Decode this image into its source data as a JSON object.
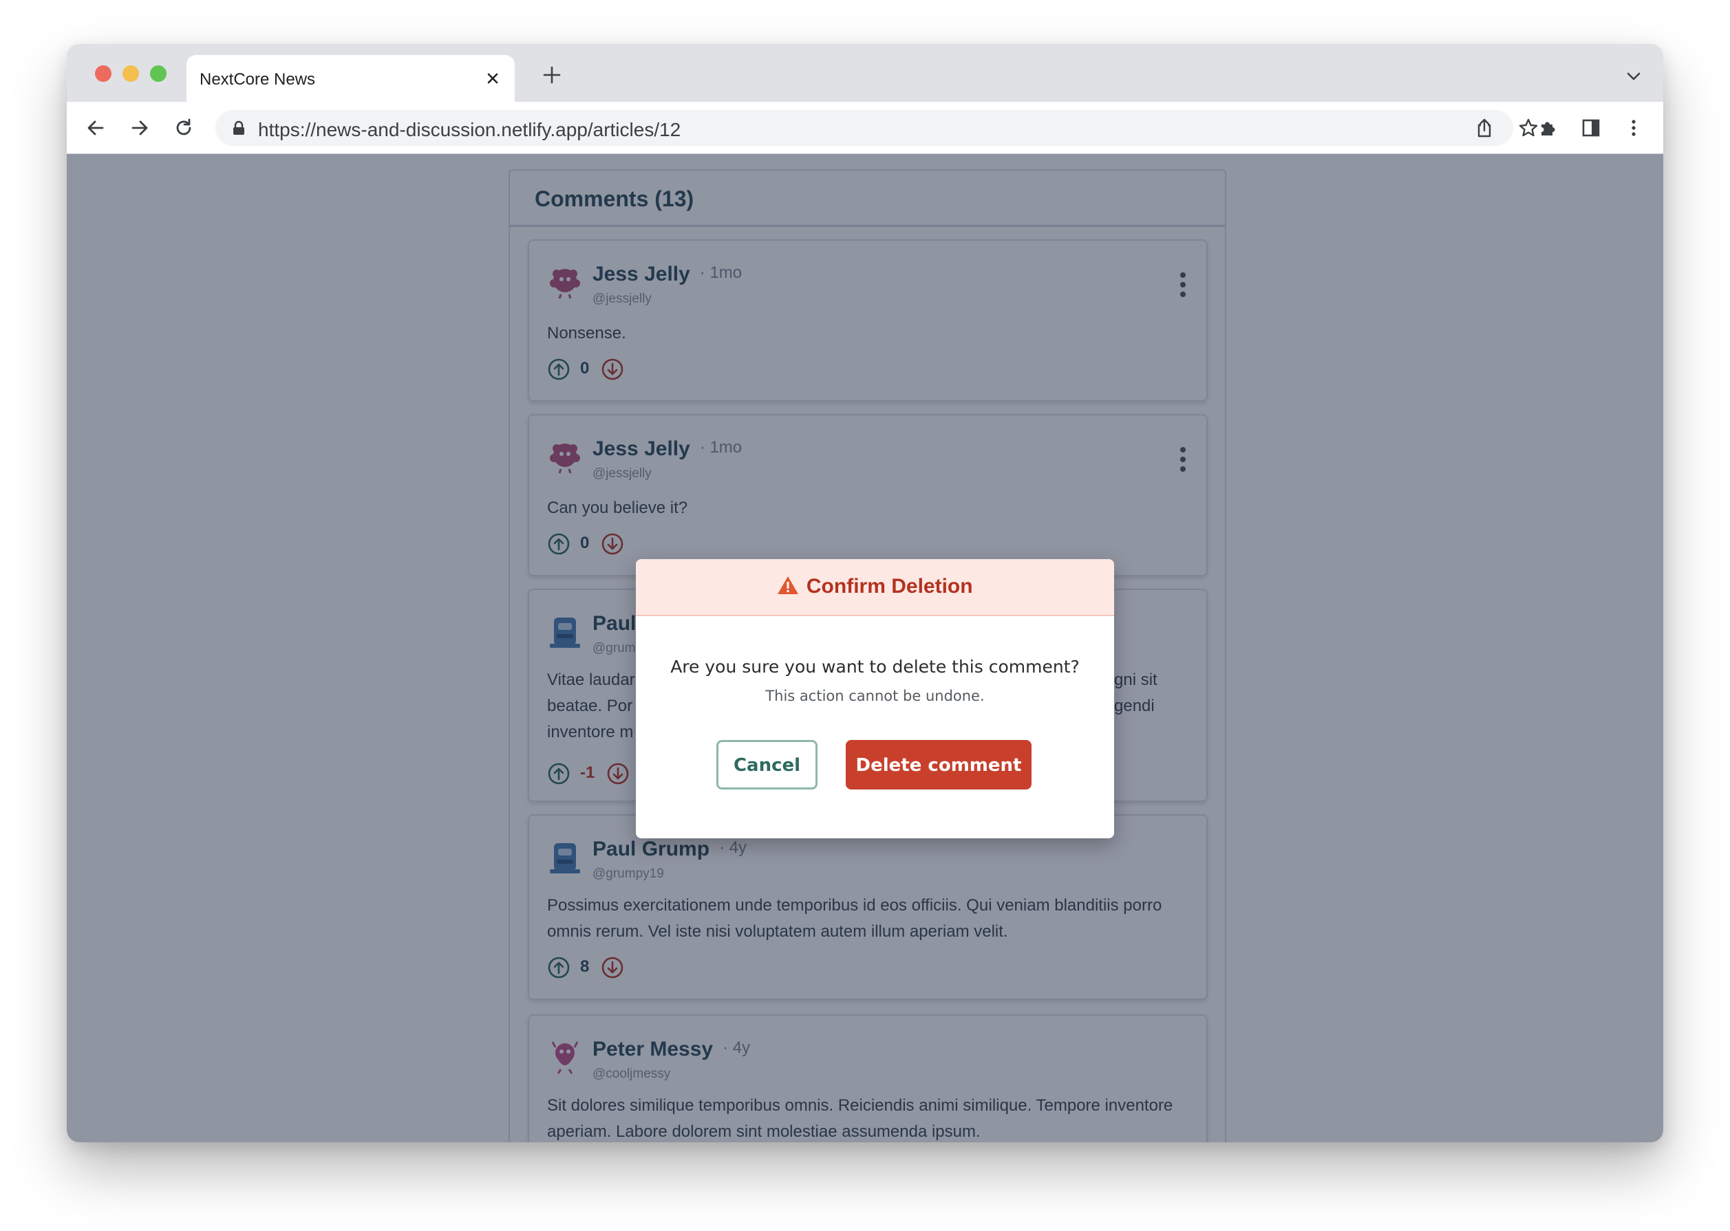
{
  "browser": {
    "tab_title": "NextCore News",
    "url": "https://news-and-discussion.netlify.app/articles/12"
  },
  "comments": {
    "header": "Comments (13)",
    "items": [
      {
        "author": "Jess Jelly",
        "age": "· 1mo",
        "handle": "@jessjelly",
        "body": "Nonsense.",
        "votes": "0"
      },
      {
        "author": "Jess Jelly",
        "age": "· 1mo",
        "handle": "@jessjelly",
        "body": "Can you believe it?",
        "votes": "0"
      },
      {
        "author": "Paul",
        "age": "",
        "handle": "@grum",
        "body_left": "Vitae laudar\nbeatae. Por\ninventore m",
        "body_right": "gni sit\ngendi",
        "votes": "-1"
      },
      {
        "author": "Paul Grump",
        "age": "· 4y",
        "handle": "@grumpy19",
        "body": "Possimus exercitationem unde temporibus id eos officiis. Qui veniam blanditiis porro omnis rerum. Vel iste nisi voluptatem autem illum aperiam velit.",
        "votes": "8"
      },
      {
        "author": "Peter Messy",
        "age": "· 4y",
        "handle": "@cooljmessy",
        "body": "Sit dolores similique temporibus omnis. Reiciendis animi similique. Tempore inventore aperiam. Labore dolorem sint molestiae assumenda ipsum.",
        "votes": ""
      }
    ]
  },
  "modal": {
    "title": "Confirm Deletion",
    "question": "Are you sure you want to delete this comment?",
    "note": "This action cannot be undone.",
    "cancel_label": "Cancel",
    "delete_label": "Delete comment"
  },
  "colors": {
    "overlay": "#17213c",
    "danger": "#c8402c",
    "modal_header_bg": "#fde8e4",
    "cancel_border": "#8fb7ad"
  },
  "icons": [
    "close-icon",
    "plus-icon",
    "chevron-down-icon",
    "back-arrow-icon",
    "forward-arrow-icon",
    "reload-icon",
    "lock-icon",
    "share-icon",
    "star-icon",
    "extension-icon",
    "side-panel-icon",
    "more-vertical-icon",
    "upvote-icon",
    "downvote-icon",
    "warning-icon"
  ]
}
